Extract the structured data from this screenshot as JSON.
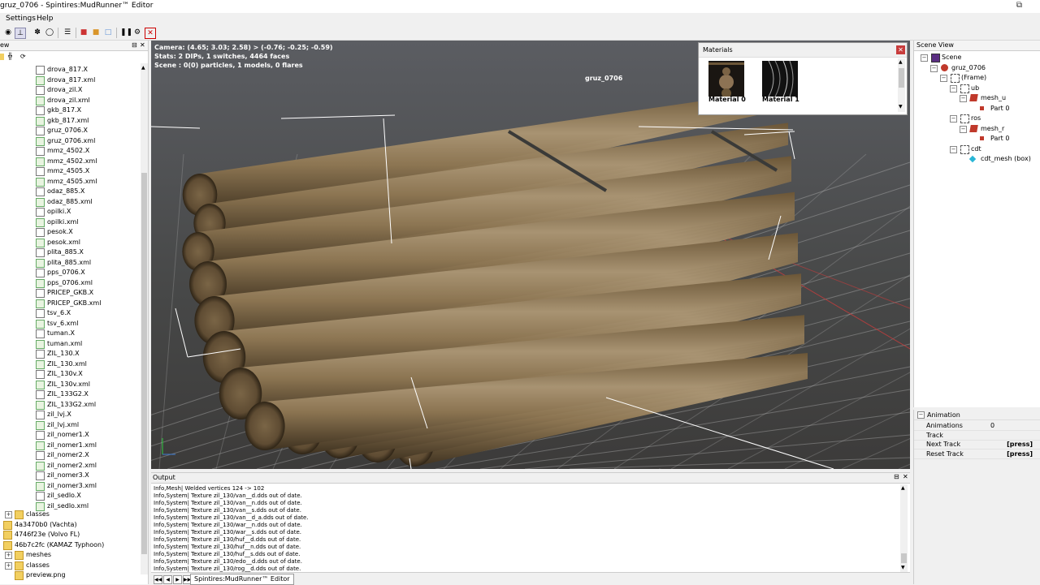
{
  "window": {
    "title": "gruz_0706 - Spintires:MudRunner™ Editor",
    "restore_icon": "restore-icon"
  },
  "menu": {
    "items": [
      "Settings",
      "Help"
    ]
  },
  "toolbar": {
    "icons": [
      "car-icon",
      "axis-icon",
      "paw-icon",
      "wheel-icon",
      "properties-icon",
      "delete-icon",
      "folder-open-icon",
      "copy-icon",
      "pause-icon",
      "settings-icon",
      "stop-icon"
    ]
  },
  "left_panel": {
    "title": "ew",
    "files": [
      {
        "name": "drova_817.X",
        "type": "x"
      },
      {
        "name": "drova_817.xml",
        "type": "xml"
      },
      {
        "name": "drova_zil.X",
        "type": "x"
      },
      {
        "name": "drova_zil.xml",
        "type": "xml"
      },
      {
        "name": "gkb_817.X",
        "type": "x"
      },
      {
        "name": "gkb_817.xml",
        "type": "xml"
      },
      {
        "name": "gruz_0706.X",
        "type": "x"
      },
      {
        "name": "gruz_0706.xml",
        "type": "xml"
      },
      {
        "name": "mmz_4502.X",
        "type": "x"
      },
      {
        "name": "mmz_4502.xml",
        "type": "xml"
      },
      {
        "name": "mmz_4505.X",
        "type": "x"
      },
      {
        "name": "mmz_4505.xml",
        "type": "xml"
      },
      {
        "name": "odaz_885.X",
        "type": "x"
      },
      {
        "name": "odaz_885.xml",
        "type": "xml"
      },
      {
        "name": "opilki.X",
        "type": "x"
      },
      {
        "name": "opilki.xml",
        "type": "xml"
      },
      {
        "name": "pesok.X",
        "type": "x"
      },
      {
        "name": "pesok.xml",
        "type": "xml"
      },
      {
        "name": "plita_885.X",
        "type": "x"
      },
      {
        "name": "plita_885.xml",
        "type": "xml"
      },
      {
        "name": "pps_0706.X",
        "type": "x"
      },
      {
        "name": "pps_0706.xml",
        "type": "xml"
      },
      {
        "name": "PRICEP_GKB.X",
        "type": "x"
      },
      {
        "name": "PRICEP_GKB.xml",
        "type": "xml"
      },
      {
        "name": "tsv_6.X",
        "type": "x"
      },
      {
        "name": "tsv_6.xml",
        "type": "xml"
      },
      {
        "name": "tuman.X",
        "type": "x"
      },
      {
        "name": "tuman.xml",
        "type": "xml"
      },
      {
        "name": "ZIL_130.X",
        "type": "x"
      },
      {
        "name": "ZIL_130.xml",
        "type": "xml"
      },
      {
        "name": "ZIL_130v.X",
        "type": "x"
      },
      {
        "name": "ZIL_130v.xml",
        "type": "xml"
      },
      {
        "name": "ZIL_133G2.X",
        "type": "x"
      },
      {
        "name": "ZIL_133G2.xml",
        "type": "xml"
      },
      {
        "name": "zil_lvj.X",
        "type": "x"
      },
      {
        "name": "zil_lvj.xml",
        "type": "xml"
      },
      {
        "name": "zil_nomer1.X",
        "type": "x"
      },
      {
        "name": "zil_nomer1.xml",
        "type": "xml"
      },
      {
        "name": "zil_nomer2.X",
        "type": "x"
      },
      {
        "name": "zil_nomer2.xml",
        "type": "xml"
      },
      {
        "name": "zil_nomer3.X",
        "type": "x"
      },
      {
        "name": "zil_nomer3.xml",
        "type": "xml"
      },
      {
        "name": "zil_sedlo.X",
        "type": "x"
      },
      {
        "name": "zil_sedlo.xml",
        "type": "xml"
      }
    ],
    "folders": [
      {
        "name": "classes",
        "indent": 1,
        "expander": true
      },
      {
        "name": "4a3470b0 (Vachta)",
        "indent": 0,
        "expander": false
      },
      {
        "name": "4746f23e (Volvo FL)",
        "indent": 0,
        "expander": false
      },
      {
        "name": "46b7c2fc (KAMAZ Typhoon)",
        "indent": 0,
        "expander": false
      },
      {
        "name": "meshes",
        "indent": 1,
        "expander": true
      },
      {
        "name": "classes",
        "indent": 1,
        "expander": true
      },
      {
        "name": "preview.png",
        "indent": 1,
        "expander": false
      }
    ]
  },
  "viewport": {
    "camera": "Camera: (4.65; 3.03; 2.58) > (-0.76; -0.25; -0.59)",
    "stats": "Stats: 2 DIPs, 1 switches, 4464 faces",
    "scene": "Scene : 0(0) particles, 1 models, 0 flares",
    "object_label": "gruz_0706"
  },
  "materials": {
    "title": "Materials",
    "items": [
      "Material 0",
      "Material 1"
    ]
  },
  "scene_view": {
    "title": "Scene View",
    "nodes": [
      {
        "label": "Scene",
        "depth": 0,
        "icon": "scene-icon"
      },
      {
        "label": "gruz_0706",
        "depth": 1,
        "icon": "model-icon"
      },
      {
        "label": "(Frame)",
        "depth": 2,
        "icon": "frame-icon"
      },
      {
        "label": "ub",
        "depth": 3,
        "icon": "frame-icon"
      },
      {
        "label": "mesh_u",
        "depth": 4,
        "icon": "mesh-icon"
      },
      {
        "label": "Part 0",
        "depth": 5,
        "icon": "part-icon"
      },
      {
        "label": "ros",
        "depth": 3,
        "icon": "frame-icon"
      },
      {
        "label": "mesh_r",
        "depth": 4,
        "icon": "mesh-icon"
      },
      {
        "label": "Part 0",
        "depth": 5,
        "icon": "part-icon"
      },
      {
        "label": "cdt",
        "depth": 3,
        "icon": "frame-icon"
      },
      {
        "label": "cdt_mesh (box)",
        "depth": 4,
        "icon": "box-icon"
      }
    ]
  },
  "animation": {
    "title": "Animation",
    "rows": [
      {
        "label": "Animations",
        "value": "0"
      },
      {
        "label": "Track",
        "value": ""
      },
      {
        "label": "Next Track",
        "value": "[press]"
      },
      {
        "label": "Reset Track",
        "value": "[press]"
      }
    ]
  },
  "output": {
    "title": "Output",
    "lines": [
      "Info,Mesh| Welded vertices 124 -> 102",
      "Info,System| Texture zil_130/van__d.dds out of date.",
      "Info,System| Texture zil_130/van__n.dds out of date.",
      "Info,System| Texture zil_130/van__s.dds out of date.",
      "Info,System| Texture zil_130/van__d_a.dds out of date.",
      "Info,System| Texture zil_130/war__n.dds out of date.",
      "Info,System| Texture zil_130/war__s.dds out of date.",
      "Info,System| Texture zil_130/huf__d.dds out of date.",
      "Info,System| Texture zil_130/huf__n.dds out of date.",
      "Info,System| Texture zil_130/huf__s.dds out of date.",
      "Info,System| Texture zil_130/edo__d.dds out of date.",
      "Info,System| Texture zil_130/rog__d.dds out of date."
    ]
  },
  "taskbar": {
    "tab": "Spintires:MudRunner™ Editor"
  }
}
